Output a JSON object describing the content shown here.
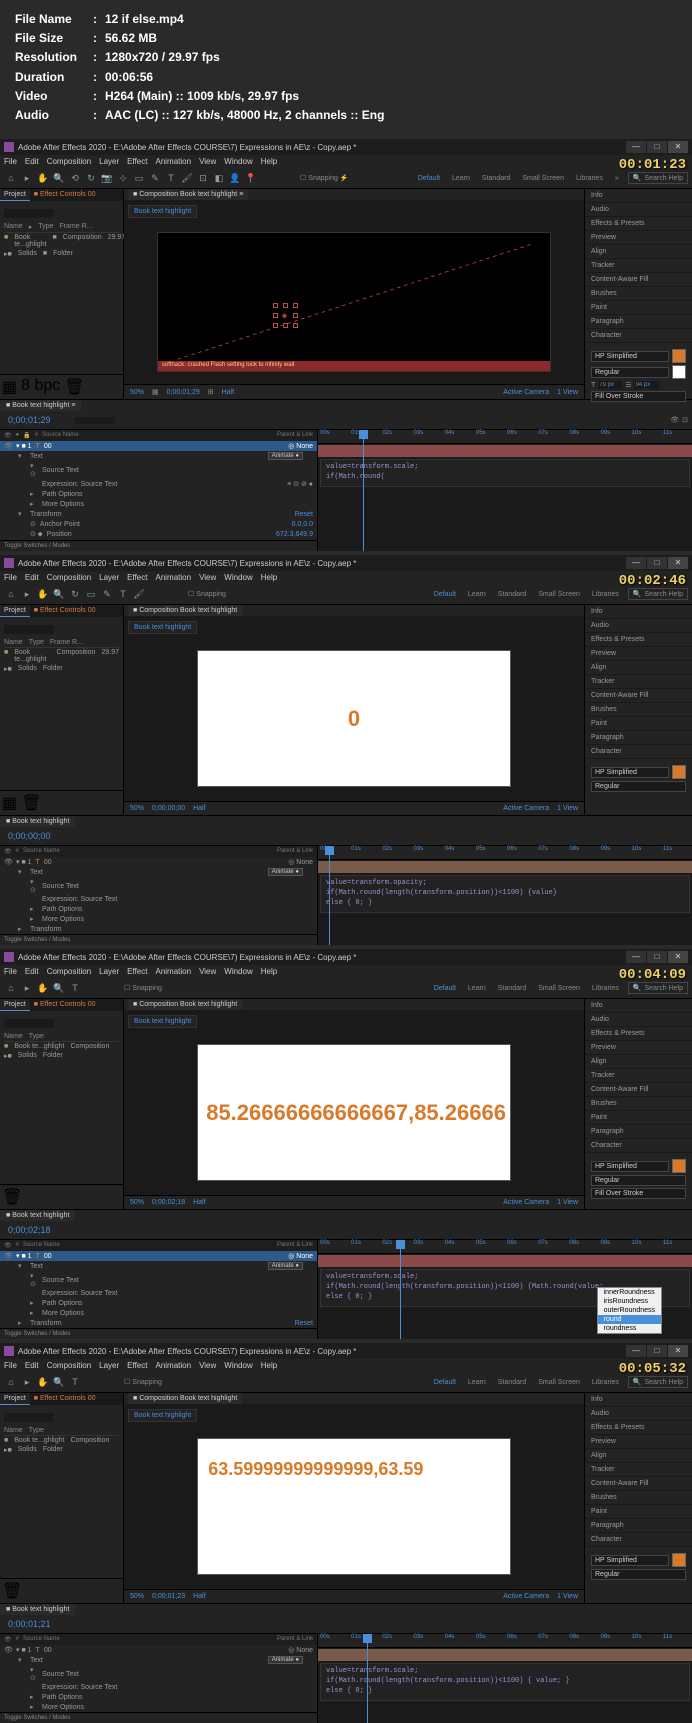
{
  "info": {
    "filename_label": "File Name",
    "filename": "12 if else.mp4",
    "filesize_label": "File Size",
    "filesize": "56.62 MB",
    "resolution_label": "Resolution",
    "resolution": "1280x720 / 29.97 fps",
    "duration_label": "Duration",
    "duration": "00:06:56",
    "video_label": "Video",
    "video": "H264 (Main) :: 1009 kb/s, 29.97 fps",
    "audio_label": "Audio",
    "audio": "AAC (LC) :: 127 kb/s, 48000 Hz, 2 channels :: Eng"
  },
  "common": {
    "app_title": "Adobe After Effects 2020 - E:\\Adobe After Effects COURSE\\7) Expressions in AE\\z - Copy.aep *",
    "menu": [
      "File",
      "Edit",
      "Composition",
      "Layer",
      "Effect",
      "Animation",
      "View",
      "Window",
      "Help"
    ],
    "snapping": "Snapping",
    "workspace": [
      "Default",
      "Learn",
      "Standard",
      "Small Screen",
      "Libraries"
    ],
    "search_help": "Search Help",
    "proj_tab": "Project",
    "ec_tab": "Effect Controls 00",
    "comp_tab": "Composition Book text highlight",
    "comp_crumb": "Book text highlight",
    "proj_search": "",
    "proj_header": [
      "Name",
      "Type",
      "Frame R..."
    ],
    "proj_items": [
      {
        "name": "Book te...ghlight",
        "type": "Composition",
        "fr": "29.97"
      },
      {
        "name": "Solids",
        "type": "Folder",
        "fr": ""
      }
    ],
    "viewer_toolbar": {
      "zoom": "50%",
      "res": "Half",
      "camera": "Active Camera",
      "views": "1 View"
    },
    "right_panels": [
      "Info",
      "Audio",
      "Effects & Presets",
      "Preview",
      "Align",
      "Tracker",
      "Content-Aware Fill",
      "Brushes",
      "Paint",
      "Paragraph",
      "Character"
    ],
    "char": {
      "font": "HP Simplified",
      "style": "Regular",
      "fill": "Fill Over Stroke"
    },
    "tl_tab": "Book text highlight",
    "tl_cols": [
      "Source Name",
      "Parent & Link"
    ],
    "tl_layer": "00",
    "tl_layer_text": "Text",
    "tl_source_text": "Source Text",
    "tl_expr_label": "Expression: Source Text",
    "tl_path": "Path Options",
    "tl_more": "More Options",
    "tl_transform": "Transform",
    "tl_anchor": "Anchor Point",
    "tl_position": "Position",
    "parent_none": "None",
    "animate": "Animate",
    "reset": "Reset",
    "toggle_sw": "Toggle Switches / Modes",
    "ruler": [
      "00s",
      "01s",
      "02s",
      "03s",
      "04s",
      "05s",
      "06s",
      "07s",
      "08s",
      "09s",
      "10s",
      "11s"
    ]
  },
  "s1": {
    "timestamp": "00:01:23",
    "tl_time": "0;00;01;29",
    "viewer_time": "0;00;01;29",
    "anchor_val": "0.0,0.0",
    "pos_val": "672.3,649.9",
    "expr": "value=transform.scale;\nif(Math.round(",
    "red_bar": "  softhack: crashed     Flash setting lock to infinity wait",
    "playhead_pct": 12
  },
  "s2": {
    "timestamp": "00:02:46",
    "tl_time": "0;00;00;00",
    "viewer_time": "0;00;00;00",
    "display": "0",
    "expr": "value=transform.opacity;\nif(Math.round(length(transform.position))<1100) {value}\nelse { 0; }",
    "playhead_pct": 3
  },
  "s3": {
    "timestamp": "00:04:09",
    "tl_time": "0;00;02;18",
    "viewer_time": "0;00;02;18",
    "display": "85.26666666666667,85.26666",
    "expr": "value=transform.scale;\nif(Math.round(length(transform.position))<1100) {Math.round(value;\nelse { 0; }",
    "autocomplete": [
      "innerRoundness",
      "irisRoundness",
      "outerRoundness",
      "round",
      "roundness"
    ],
    "ac_selected": 3,
    "playhead_pct": 22
  },
  "s4": {
    "timestamp": "00:05:32",
    "tl_time": "0;00;01;21",
    "viewer_time": "0;00;01;23",
    "display": "63.59999999999999,63.59",
    "expr": "value=transform.scale;\nif(Math.round(length(transform.position))<1100) { value; }\nelse { 0; }",
    "playhead_pct": 13
  }
}
